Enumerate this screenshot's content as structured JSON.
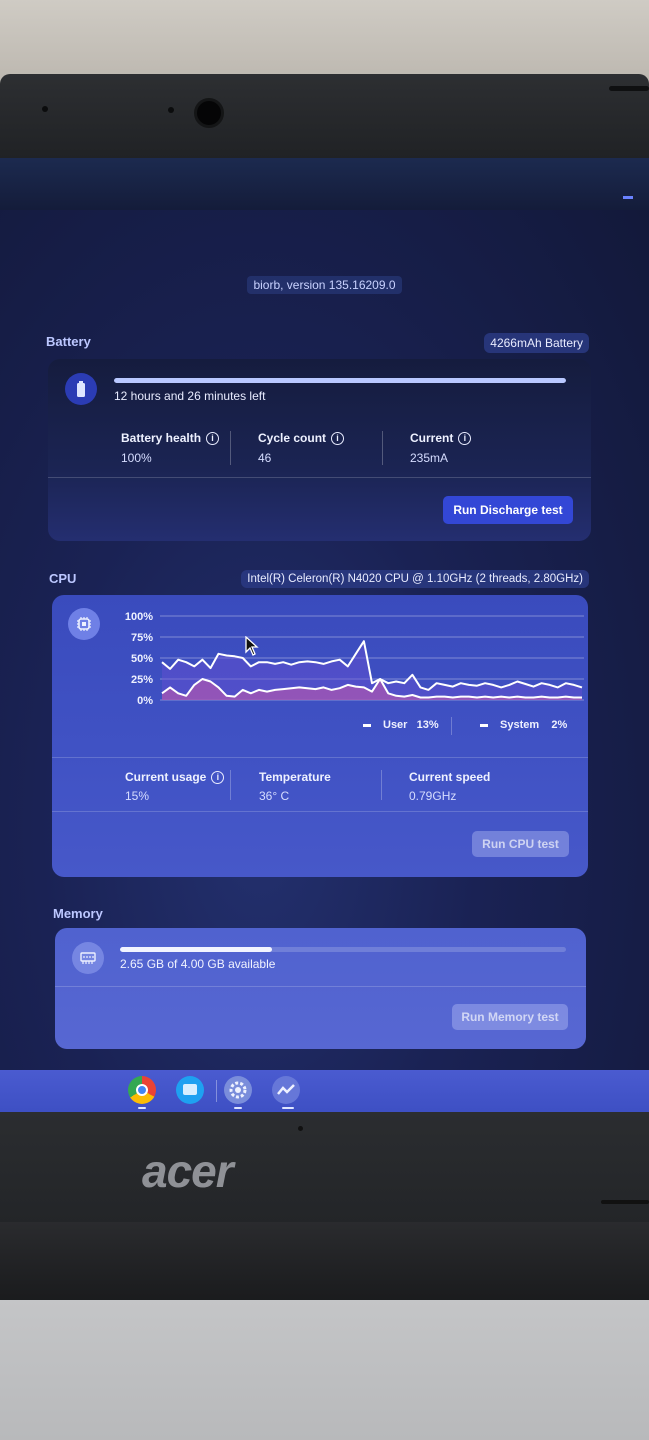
{
  "app": {
    "version_text": "biorb, version 135.16209.0"
  },
  "battery": {
    "section_title": "Battery",
    "capacity_chip": "4266mAh Battery",
    "charge_fraction": 1.0,
    "time_left": "12 hours and 26 minutes left",
    "stats": [
      {
        "label": "Battery health",
        "value": "100%",
        "has_info": true
      },
      {
        "label": "Cycle count",
        "value": "46",
        "has_info": true
      },
      {
        "label": "Current",
        "value": "235mA",
        "has_info": true
      }
    ],
    "button_label": "Run Discharge test",
    "icon": "battery-icon"
  },
  "cpu": {
    "section_title": "CPU",
    "model_chip": "Intel(R) Celeron(R) N4020 CPU @ 1.10GHz (2 threads, 2.80GHz)",
    "icon": "cpu-chip-icon",
    "chart_data": {
      "type": "area",
      "y_ticks": [
        "100%",
        "75%",
        "50%",
        "25%",
        "0%"
      ],
      "ylim": [
        0,
        100
      ],
      "grid": true,
      "legend_placement": "bottom-right",
      "series": [
        {
          "name": "User",
          "values": [
            45,
            37,
            48,
            45,
            40,
            48,
            38,
            55,
            53,
            52,
            50,
            40,
            45,
            45,
            43,
            45,
            42,
            45,
            46,
            45,
            43,
            46,
            48,
            40,
            55,
            70,
            20,
            25,
            20,
            22,
            20,
            30,
            15,
            12,
            20,
            18,
            16,
            20,
            18,
            17,
            20,
            18,
            15,
            18,
            22,
            19,
            16,
            20,
            18,
            15,
            20,
            18,
            15
          ]
        },
        {
          "name": "System",
          "values": [
            8,
            15,
            8,
            5,
            18,
            25,
            22,
            15,
            5,
            4,
            12,
            8,
            12,
            10,
            12,
            13,
            14,
            15,
            14,
            13,
            15,
            12,
            14,
            18,
            16,
            15,
            10,
            25,
            8,
            5,
            4,
            6,
            3,
            3,
            4,
            4,
            3,
            4,
            4,
            3,
            4,
            3,
            4,
            3,
            4,
            3,
            3,
            4,
            3,
            3,
            4,
            3,
            3
          ]
        }
      ],
      "legend": [
        {
          "name": "User",
          "value": "13%"
        },
        {
          "name": "System",
          "value": "2%"
        }
      ]
    },
    "stats": [
      {
        "label": "Current usage",
        "value": "15%",
        "has_info": true
      },
      {
        "label": "Temperature",
        "value": "36° C",
        "has_info": false
      },
      {
        "label": "Current speed",
        "value": "0.79GHz",
        "has_info": false
      }
    ],
    "button_label": "Run CPU test"
  },
  "memory": {
    "section_title": "Memory",
    "icon": "memory-icon",
    "usage_fraction": 0.34,
    "available_text": "2.65 GB of 4.00 GB available",
    "button_label": "Run Memory test"
  },
  "shelf": {
    "apps": [
      {
        "icon": "chrome-icon"
      },
      {
        "icon": "files-icon"
      },
      {
        "icon": "settings-icon"
      },
      {
        "icon": "diagnostics-icon"
      }
    ]
  },
  "hardware": {
    "brand": "acer"
  }
}
